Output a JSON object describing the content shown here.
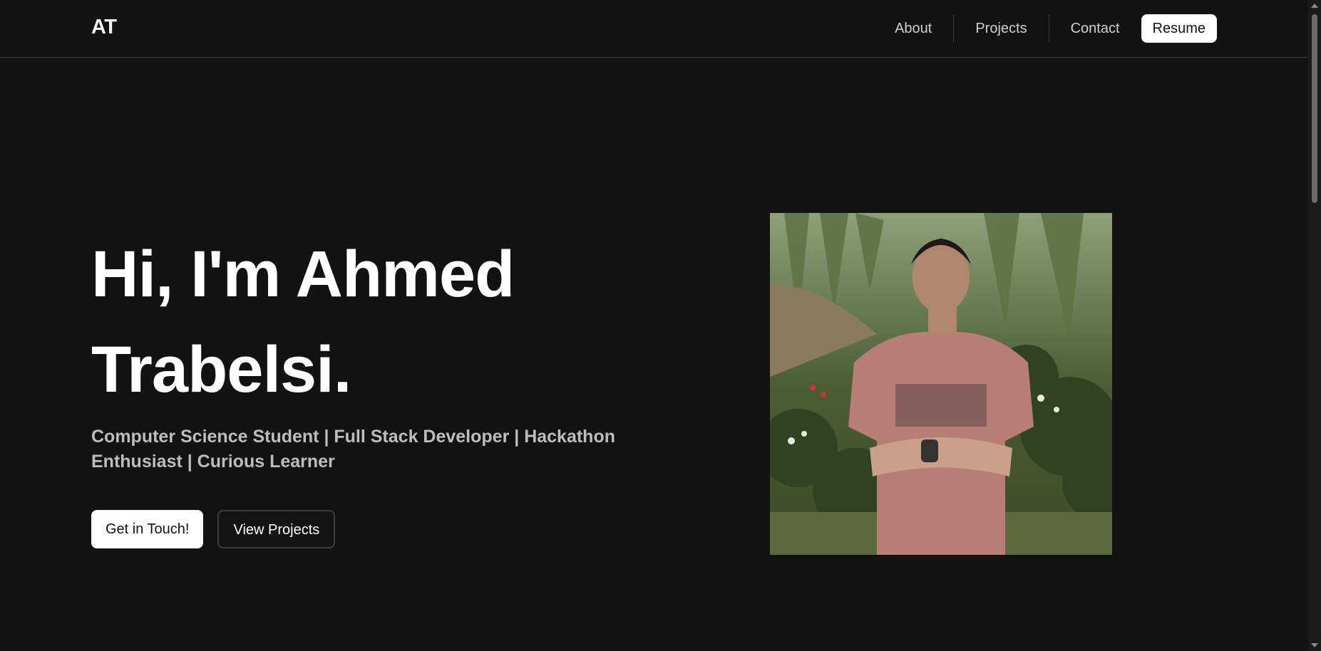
{
  "header": {
    "logo": "AT",
    "nav": [
      {
        "label": "About"
      },
      {
        "label": "Projects"
      },
      {
        "label": "Contact"
      }
    ],
    "resume_label": "Resume"
  },
  "hero": {
    "title_line1": "Hi, I'm Ahmed",
    "title_line2": "Trabelsi.",
    "subtitle": "Computer Science Student | Full Stack Developer | Hackathon Enthusiast | Curious Learner",
    "primary_button": "Get in Touch!",
    "secondary_button": "View Projects"
  },
  "photo": {
    "icon": "profile-photo"
  },
  "colors": {
    "background": "#121212",
    "accent": "#ffffff",
    "subtitle": "#bdbdbd",
    "shirt": "#b97d78"
  }
}
